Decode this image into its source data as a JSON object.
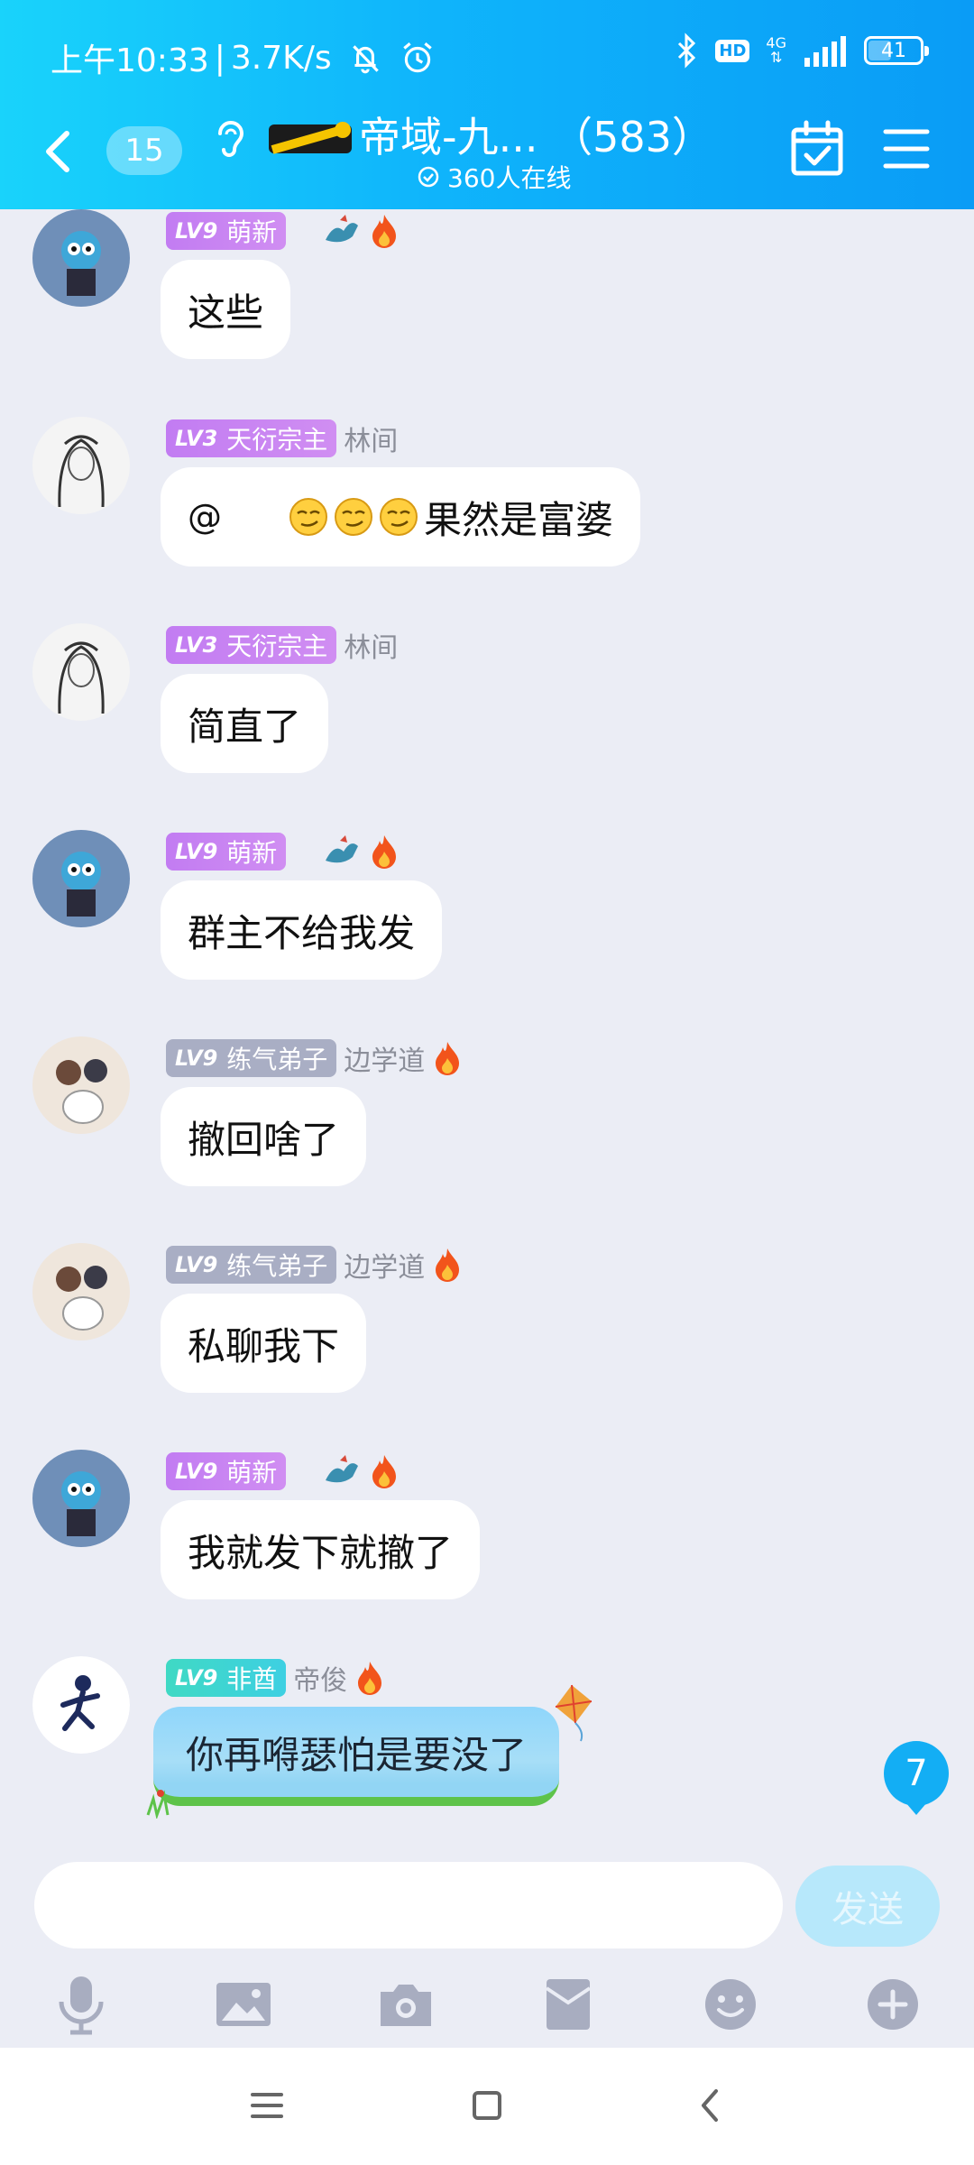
{
  "status_bar": {
    "time": "上午10:33",
    "separator": "|",
    "speed": "3.7K/s",
    "hd": "HD",
    "net_type": "4G",
    "battery": "41"
  },
  "nav": {
    "unread_count": "15",
    "group_title": "帝域-九... （583）",
    "online": "360人在线"
  },
  "messages": [
    {
      "level": "LV9",
      "title": "萌新",
      "name": "",
      "text": "这些"
    },
    {
      "level": "LV3",
      "title": "天衍宗主",
      "name": "林间",
      "at": "@",
      "text": "果然是富婆"
    },
    {
      "level": "LV3",
      "title": "天衍宗主",
      "name": "林间",
      "text": "简直了"
    },
    {
      "level": "LV9",
      "title": "萌新",
      "name": "",
      "text": "群主不给我发"
    },
    {
      "level": "LV9",
      "title": "练气弟子",
      "name": "边学道",
      "text": "撤回啥了"
    },
    {
      "level": "LV9",
      "title": "练气弟子",
      "name": "边学道",
      "text": "私聊我下"
    },
    {
      "level": "LV9",
      "title": "萌新",
      "name": "",
      "text": "我就发下就撤了"
    },
    {
      "level": "LV9",
      "title": "非酋",
      "name": "帝俊",
      "text": "你再嘚瑟怕是要没了"
    }
  ],
  "new_messages_count": "7",
  "input": {
    "value": "",
    "send_label": "发送"
  },
  "colors": {
    "header_start": "#19d3fb",
    "header_end": "#0a9cf6",
    "badge_purple": "#c27cf2",
    "badge_gray": "#a9aec4",
    "badge_green": "#3fd9c4",
    "background": "#ebedf5"
  },
  "icons": [
    "back-icon",
    "ear-icon",
    "group-logo-icon",
    "calendar-check-icon",
    "menu-icon",
    "microphone-icon",
    "image-icon",
    "camera-icon",
    "red-packet-icon",
    "emoji-icon",
    "plus-icon"
  ]
}
